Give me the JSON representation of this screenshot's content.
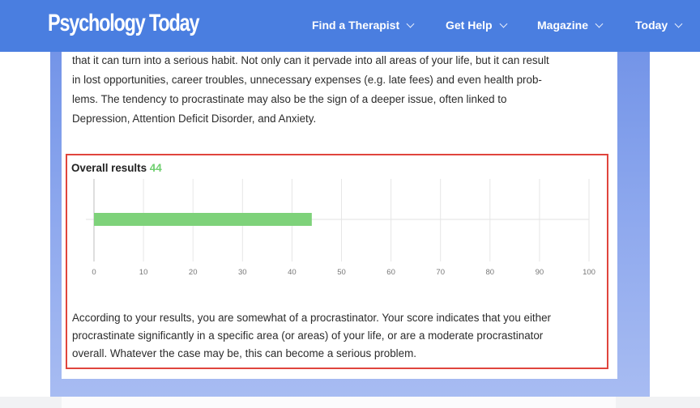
{
  "header": {
    "logo": "Psychology Today",
    "nav": [
      {
        "label": "Find a Therapist"
      },
      {
        "label": "Get Help"
      },
      {
        "label": "Magazine"
      },
      {
        "label": "Today"
      }
    ]
  },
  "article": {
    "intro_lines": [
      "that it can turn into a serious habit. Not only can it pervade into all areas of your life, but it can result",
      "in lost opportunities, career troubles, unnecessary expenses (e.g. late fees) and even health prob-",
      "lems. The tendency to procrastinate may also be the sign of a deeper issue, often linked to",
      "Depression, Attention Deficit Disorder, and Anxiety."
    ]
  },
  "results": {
    "title": "Overall results",
    "score": "44",
    "verdict": [
      "According to your results, you are somewhat of a procrastinator. Your score indicates that you either",
      "procrastinate significantly in a specific area (or areas) of your life, or are a moderate procrastinator",
      "overall. Whatever the case may be, this can become a serious problem."
    ]
  },
  "colors": {
    "header": "#4a7ee0",
    "bar": "#7ed27a",
    "score": "#6fcf6f",
    "highlight_border": "#e0453d"
  },
  "chart_data": {
    "type": "bar",
    "orientation": "horizontal",
    "values": [
      44
    ],
    "xlim": [
      0,
      100
    ],
    "xticks": [
      "0",
      "10",
      "20",
      "30",
      "40",
      "50",
      "60",
      "70",
      "80",
      "90",
      "100"
    ],
    "grid": true
  }
}
